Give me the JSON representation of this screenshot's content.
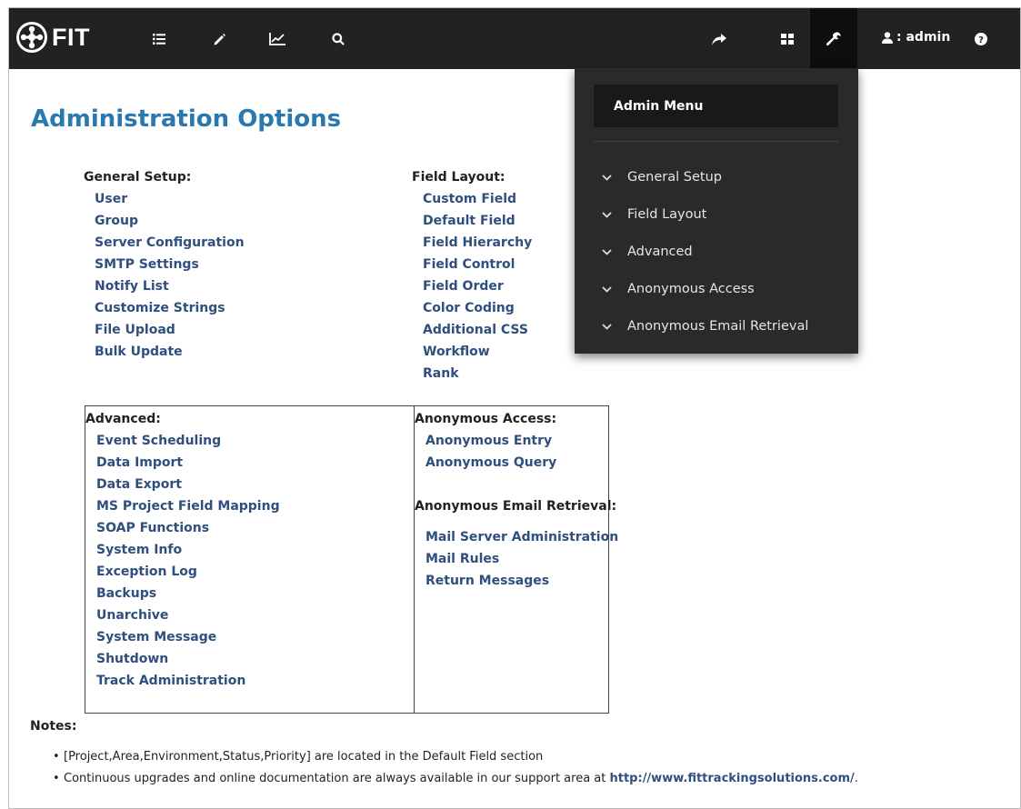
{
  "brand": {
    "name": "FIT"
  },
  "navbar": {
    "icons": [
      "list-icon",
      "pencil-icon",
      "chart-icon",
      "search-icon",
      "share-icon",
      "grid-icon",
      "wrench-icon",
      "help-icon"
    ],
    "user_label": ": admin"
  },
  "page": {
    "title": "Administration Options"
  },
  "general_setup": {
    "title": "General Setup:",
    "items": [
      "User",
      "Group",
      "Server Configuration",
      "SMTP Settings",
      "Notify List",
      "Customize Strings",
      "File Upload",
      "Bulk Update"
    ]
  },
  "field_layout": {
    "title": "Field Layout:",
    "items": [
      "Custom Field",
      "Default Field",
      "Field Hierarchy",
      "Field Control",
      "Field Order",
      "Color Coding",
      "Additional CSS",
      "Workflow",
      "Rank"
    ]
  },
  "advanced": {
    "title": "Advanced:",
    "items": [
      "Event Scheduling",
      "Data Import",
      "Data Export",
      "MS Project Field Mapping",
      "SOAP Functions",
      "System Info",
      "Exception Log",
      "Backups",
      "Unarchive",
      "System Message",
      "Shutdown",
      "Track Administration"
    ]
  },
  "anonymous_access": {
    "title": "Anonymous Access:",
    "items": [
      "Anonymous Entry",
      "Anonymous Query"
    ]
  },
  "anonymous_email": {
    "title": "Anonymous Email Retrieval:",
    "items": [
      "Mail Server Administration",
      "Mail Rules",
      "Return Messages"
    ]
  },
  "notes": {
    "label": "Notes:",
    "items": [
      "[Project,Area,Environment,Status,Priority] are located in the Default Field section",
      "Continuous upgrades and online documentation are always available in our support area at "
    ],
    "url": "http://www.fittrackingsolutions.com/",
    "url_suffix": "."
  },
  "admin_menu": {
    "header": "Admin Menu",
    "items": [
      "General Setup",
      "Field Layout",
      "Advanced",
      "Anonymous Access",
      "Anonymous Email Retrieval"
    ]
  },
  "colors": {
    "navbar": "#222222",
    "title": "#2a78b0",
    "link": "#2f4f7f",
    "menu_bg": "#2a2a2a"
  }
}
